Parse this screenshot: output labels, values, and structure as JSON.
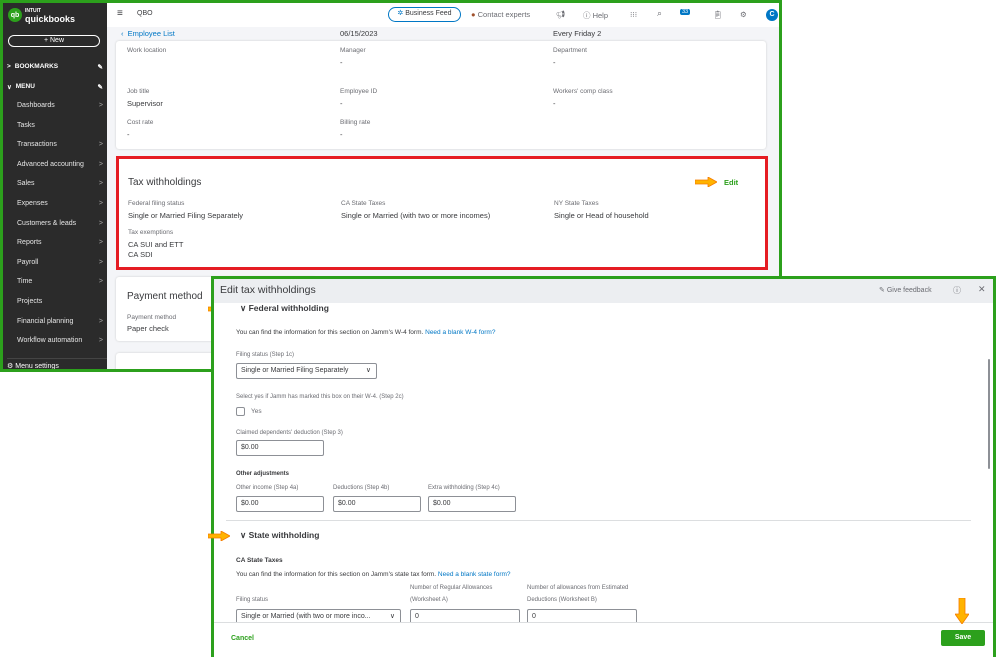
{
  "app": {
    "logo_brand": "INTUIT",
    "logo_name": "quickbooks",
    "new_label": "+ New",
    "bookmarks": "BOOKMARKS",
    "menu": "MENU",
    "company": "QBO",
    "nav": [
      {
        "label": "Dashboards",
        "chev": true
      },
      {
        "label": "Tasks",
        "chev": false
      },
      {
        "label": "Transactions",
        "chev": true
      },
      {
        "label": "Advanced accounting",
        "chev": true
      },
      {
        "label": "Sales",
        "chev": true
      },
      {
        "label": "Expenses",
        "chev": true
      },
      {
        "label": "Customers & leads",
        "chev": true
      },
      {
        "label": "Reports",
        "chev": true
      },
      {
        "label": "Payroll",
        "chev": true
      },
      {
        "label": "Time",
        "chev": true
      },
      {
        "label": "Projects",
        "chev": false
      },
      {
        "label": "Financial planning",
        "chev": true
      },
      {
        "label": "Workflow automation",
        "chev": true
      }
    ],
    "menu_settings": "Menu settings"
  },
  "topbar": {
    "business_feed": "Business Feed",
    "contact_experts": "Contact experts",
    "help": "Help",
    "notif_count": "33",
    "avatar": "C"
  },
  "breadcrumb": "Employee List",
  "employment": {
    "hire_date": "06/15/2023",
    "pay_schedule": "Every Friday 2",
    "fields": [
      {
        "label": "Work location",
        "value": ""
      },
      {
        "label": "Manager",
        "value": "-"
      },
      {
        "label": "Department",
        "value": "-"
      },
      {
        "label": "Job title",
        "value": "Supervisor"
      },
      {
        "label": "Employee ID",
        "value": "-"
      },
      {
        "label": "Workers' comp class",
        "value": "-"
      },
      {
        "label": "Cost rate",
        "value": "-"
      },
      {
        "label": "Billing rate",
        "value": "-"
      }
    ]
  },
  "tax": {
    "title": "Tax withholdings",
    "edit": "Edit",
    "federal_label": "Federal filing status",
    "federal_value": "Single or Married Filing Separately",
    "ca_label": "CA State Taxes",
    "ca_value": "Single or Married (with two or more incomes)",
    "ny_label": "NY State Taxes",
    "ny_value": "Single or Head of household",
    "exemptions_label": "Tax exemptions",
    "exemptions": [
      "CA SUI and ETT",
      "CA SDI"
    ]
  },
  "payment": {
    "title": "Payment method",
    "label": "Payment method",
    "value": "Paper check"
  },
  "dialog": {
    "title": "Edit tax withholdings",
    "feedback": "Give feedback",
    "federal": {
      "heading": "Federal withholding",
      "info": "You can find the information for this section on Jamm's W-4 form.",
      "info_link": "Need a blank W-4 form?",
      "filing_label": "Filing status (Step 1c)",
      "filing_value": "Single or Married Filing Separately",
      "checkbox_label": "Select yes if Jamm has marked this box on their W-4. (Step 2c)",
      "checkbox_text": "Yes",
      "checked": false,
      "dependents_label": "Claimed dependents' deduction (Step 3)",
      "dependents_value": "$0.00",
      "other_adj": "Other adjustments",
      "other_income_label": "Other income (Step 4a)",
      "other_income_value": "$0.00",
      "deductions_label": "Deductions (Step 4b)",
      "deductions_value": "$0.00",
      "extra_label": "Extra withholding (Step 4c)",
      "extra_value": "$0.00"
    },
    "state": {
      "heading": "State withholding",
      "sub": "CA State Taxes",
      "info": "You can find the information for this section on Jamm's state tax form.",
      "info_link": "Need a blank state form?",
      "filing_label": "Filing status",
      "filing_value": "Single or Married (with two or more inco...",
      "regular_label_1": "Number of Regular Allowances",
      "regular_label_2": "(Worksheet A)",
      "regular_value": "0",
      "estimated_label_1": "Number of allowances from Estimated",
      "estimated_label_2": "Deductions (Worksheet B)",
      "estimated_value": "0"
    },
    "cancel": "Cancel",
    "save": "Save"
  },
  "colors": {
    "frame_green": "#2ca01c",
    "highlight_red": "#e51c23",
    "link_blue": "#0077c5",
    "arrow_orange": "#ffb300"
  }
}
